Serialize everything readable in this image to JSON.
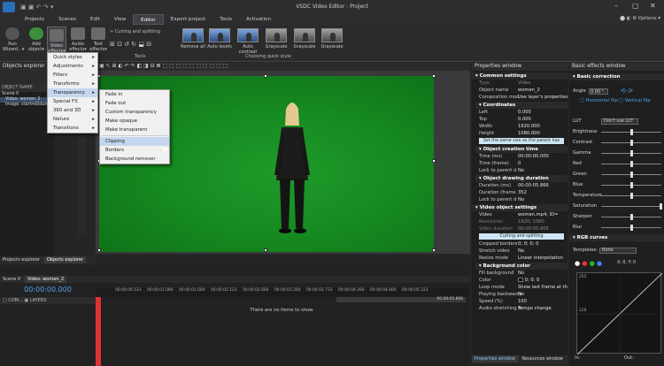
{
  "window": {
    "title": "VSDC Video Editor - Project",
    "options_label": "Options"
  },
  "menu": [
    "Projects",
    "Scenes",
    "Edit",
    "View",
    "Editor",
    "Export project",
    "Tools",
    "Activation"
  ],
  "ribbon": {
    "buttons": [
      {
        "label": "Run Wizard...",
        "arrow": "▾"
      },
      {
        "label": "Add object",
        "arrow": "▾"
      },
      {
        "label": "Video effects",
        "arrow": "▾"
      },
      {
        "label": "Audio effects",
        "arrow": "▾"
      },
      {
        "label": "Text effects",
        "arrow": "▾"
      }
    ],
    "cutting_label": "Cutting and splitting",
    "tools_label": "Tools",
    "quick_styles": [
      "Remove all",
      "Auto levels",
      "Auto contrast",
      "Grayscale",
      "Grayscale",
      "Grayscale"
    ],
    "choosing_label": "Choosing quick style"
  },
  "objects_explorer": {
    "title": "Objects explorer",
    "object_name_header": "OBJECT NAME",
    "tree": [
      "Scene 0",
      "Video: women_2",
      "Image: startmeldung"
    ]
  },
  "video_effects_menu": [
    "Quick styles",
    "Adjustments",
    "Filters",
    "Transforms",
    "Transparency",
    "Special FX",
    "360 and 3D",
    "Nature",
    "Transitions"
  ],
  "transparency_menu": [
    "Fade in",
    "Fade out",
    "Custom transparency",
    "Make opaque",
    "Make transparent",
    "Clipping",
    "Borders",
    "Background remover"
  ],
  "properties": {
    "title": "Properties window",
    "common_settings": "Common settings",
    "type_label": "Type",
    "type_value": "Video",
    "object_name_label": "Object name",
    "object_name_value": "women_2",
    "composition_label": "Composition mod",
    "composition_value": "Use layer's properties",
    "coordinates": "Coordinates",
    "left_label": "Left",
    "left_value": "0.000",
    "top_label": "Top",
    "top_value": "0.000",
    "width_label": "Width",
    "width_value": "1920.000",
    "height_label": "Height",
    "height_value": "1080.000",
    "same_size_label": "Set the same size as the parent has",
    "creation_time": "Object creation time",
    "time_ms_label": "Time (ms)",
    "time_ms_value": "00:00:00.000",
    "time_frame_label": "Time (frame)",
    "time_frame_value": "0",
    "lock_parent_label": "Lock to parent d",
    "lock_parent_value": "No",
    "drawing_duration": "Object drawing duration",
    "duration_ms_label": "Duration (ms)",
    "duration_ms_value": "00:00:05.866",
    "duration_frame_label": "Duration (frame",
    "duration_frame_value": "352",
    "lock_parent2_label": "Lock to parent d",
    "lock_parent2_value": "No",
    "video_settings": "Video object settings",
    "video_label": "Video",
    "video_value": "women.mp4; ID=",
    "resolution_label": "Resolution",
    "resolution_value": "1920; 1080",
    "video_duration_label": "Video duration",
    "video_duration_value": "00:00:05.866",
    "cutting_button": "Cutting and splitting",
    "cropped_label": "Cropped borders",
    "cropped_value": "0; 0; 0; 0",
    "stretch_label": "Stretch video",
    "stretch_value": "No",
    "resize_label": "Resize mode",
    "resize_value": "Linear interpolation",
    "background_color": "Background color",
    "fill_bg_label": "Fill background",
    "fill_bg_value": "No",
    "color_label": "Color",
    "color_value": "0; 0; 0",
    "loop_label": "Loop mode",
    "loop_value": "Show last frame at th",
    "playing_back_label": "Playing backwards",
    "playing_back_value": "No",
    "speed_label": "Speed (%)",
    "speed_value": "100",
    "audio_stretch_label": "Audio stretching m",
    "audio_stretch_value": "Tempo change",
    "tabs": [
      "Properties window",
      "Resources window"
    ]
  },
  "effects": {
    "title": "Basic effects window",
    "basic_correction": "Basic correction",
    "angle_label": "Angle",
    "angle_value": "0.00 °",
    "hflip_label": "Horizontal flip",
    "vflip_label": "Vertical flip",
    "lut_label": "LUT",
    "lut_value": "Don't use LUT",
    "sliders": [
      {
        "name": "Brightness",
        "value": "0",
        "level": 0.5
      },
      {
        "name": "Contrast",
        "value": "0",
        "level": 0.5
      },
      {
        "name": "Gamma",
        "value": "0",
        "level": 0.5
      },
      {
        "name": "Red",
        "value": "0",
        "level": 0.5
      },
      {
        "name": "Green",
        "value": "0",
        "level": 0.5
      },
      {
        "name": "Blue",
        "value": "0",
        "level": 0.5
      },
      {
        "name": "Temperature",
        "value": "0",
        "level": 0.5
      },
      {
        "name": "Saturation",
        "value": "100",
        "level": 1.0
      },
      {
        "name": "Sharpen",
        "value": "0",
        "level": 0.5
      },
      {
        "name": "Blur",
        "value": "0",
        "level": 0.5
      }
    ],
    "rgb_curves": "RGB curves",
    "templates_label": "Templates:",
    "templates_value": "None",
    "xy_readout": "X: 0, Y: 0",
    "curve_top": "255",
    "curve_mid": "128",
    "in_label": "In:",
    "out_label": "Out:"
  },
  "canvas_toolbar": {
    "resolution": "720p"
  },
  "timeline": {
    "explorer_tabs": [
      "Projects explorer",
      "Objects explorer"
    ],
    "tabs": [
      "Scene 0",
      "Video: women_2"
    ],
    "current_time": "00:00:00.000",
    "ruler": [
      "00:00:00.000",
      "00:00:00.533",
      "00:00:01.066",
      "00:00:01.600",
      "00:00:02.133",
      "00:00:02.666",
      "00:00:03.200",
      "00:00:03.733",
      "00:00:04.266",
      "00:00:04.800",
      "00:00:05.333",
      "00:00:05.866"
    ],
    "end_time": "00:00:05.866",
    "com_label": "COM...",
    "layers_label": "LAYERS",
    "empty_text": "There are no items to show."
  },
  "colors": {
    "accent": "#2b6fb8",
    "green_screen": "#168a20"
  }
}
